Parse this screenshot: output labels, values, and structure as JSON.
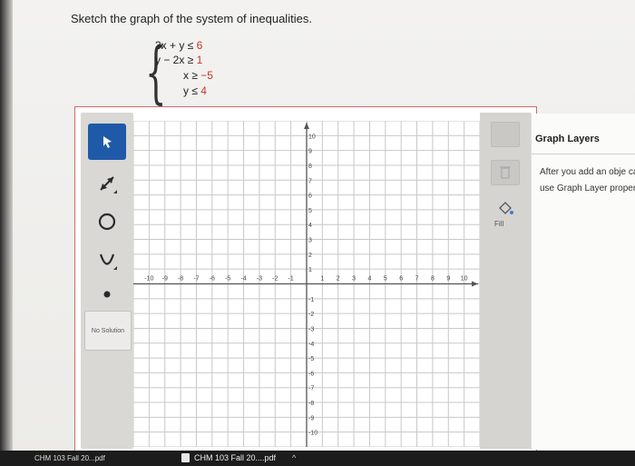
{
  "prompt": "Sketch the graph of the system of inequalities.",
  "system": {
    "lines": [
      {
        "lhs": "3x + y ≤ ",
        "rhs": "6"
      },
      {
        "lhs": "y − 2x ≥ ",
        "rhs": "1"
      },
      {
        "lhs": "x ≥ ",
        "rhs": "−5"
      },
      {
        "lhs": "y ≤ ",
        "rhs": "4"
      }
    ]
  },
  "toolbar": {
    "tools": [
      "pointer-tool",
      "ray-line-tool",
      "circle-tool",
      "parabola-tool",
      "point-tool"
    ],
    "active_tool": "pointer-tool",
    "no_solution_label": "No Solution"
  },
  "graph": {
    "x_range": [
      -10,
      10
    ],
    "y_range": [
      -10,
      10
    ],
    "x_ticks": [
      "-10",
      "-9",
      "-8",
      "-7",
      "-6",
      "-5",
      "-4",
      "-3",
      "-2",
      "-1",
      "1",
      "2",
      "3",
      "4",
      "5",
      "6",
      "7",
      "8",
      "9",
      "10"
    ],
    "y_ticks": [
      "10",
      "9",
      "8",
      "7",
      "6",
      "5",
      "4",
      "3",
      "2",
      "1",
      "-1",
      "-2",
      "-3",
      "-4",
      "-5",
      "-6",
      "-7",
      "-8",
      "-9",
      "-10"
    ]
  },
  "right_toolbar": {
    "fill_label": "Fill"
  },
  "layers_panel": {
    "title": "Graph Layers",
    "text": "After you add an obje can use Graph Layer properties."
  },
  "taskbar": {
    "file1": "CHM 103 Fall 20...pdf",
    "file2": "CHM 103 Fall 20....pdf"
  },
  "colors": {
    "accent": "#1f5aa8",
    "constant_red": "#c0392b",
    "border_red": "#c96b6b"
  }
}
